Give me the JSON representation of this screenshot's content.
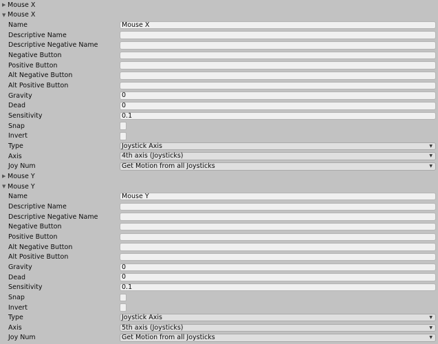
{
  "field_labels": [
    "Name",
    "Descriptive Name",
    "Descriptive Negative Name",
    "Negative Button",
    "Positive Button",
    "Alt Negative Button",
    "Alt Positive Button",
    "Gravity",
    "Dead",
    "Sensitivity",
    "Snap",
    "Invert",
    "Type",
    "Axis",
    "Joy Num"
  ],
  "axes": [
    {
      "title": "Mouse X",
      "expanded": false
    },
    {
      "title": "Mouse X",
      "expanded": true,
      "values": {
        "Name": "Mouse X",
        "Descriptive Name": "",
        "Descriptive Negative Name": "",
        "Negative Button": "",
        "Positive Button": "",
        "Alt Negative Button": "",
        "Alt Positive Button": "",
        "Gravity": "0",
        "Dead": "0",
        "Sensitivity": "0.1",
        "Snap": false,
        "Invert": false,
        "Type": "Joystick Axis",
        "Axis": "4th axis (Joysticks)",
        "Joy Num": "Get Motion from all Joysticks"
      }
    },
    {
      "title": "Mouse Y",
      "expanded": false
    },
    {
      "title": "Mouse Y",
      "expanded": true,
      "values": {
        "Name": "Mouse Y",
        "Descriptive Name": "",
        "Descriptive Negative Name": "",
        "Negative Button": "",
        "Positive Button": "",
        "Alt Negative Button": "",
        "Alt Positive Button": "",
        "Gravity": "0",
        "Dead": "0",
        "Sensitivity": "0.1",
        "Snap": false,
        "Invert": false,
        "Type": "Joystick Axis",
        "Axis": "5th axis (Joysticks)",
        "Joy Num": "Get Motion from all Joysticks"
      }
    }
  ],
  "icons": {
    "collapsed": "triangle-right-icon",
    "expanded": "triangle-down-icon",
    "dropdown": "dropdown-arrow-icon"
  }
}
